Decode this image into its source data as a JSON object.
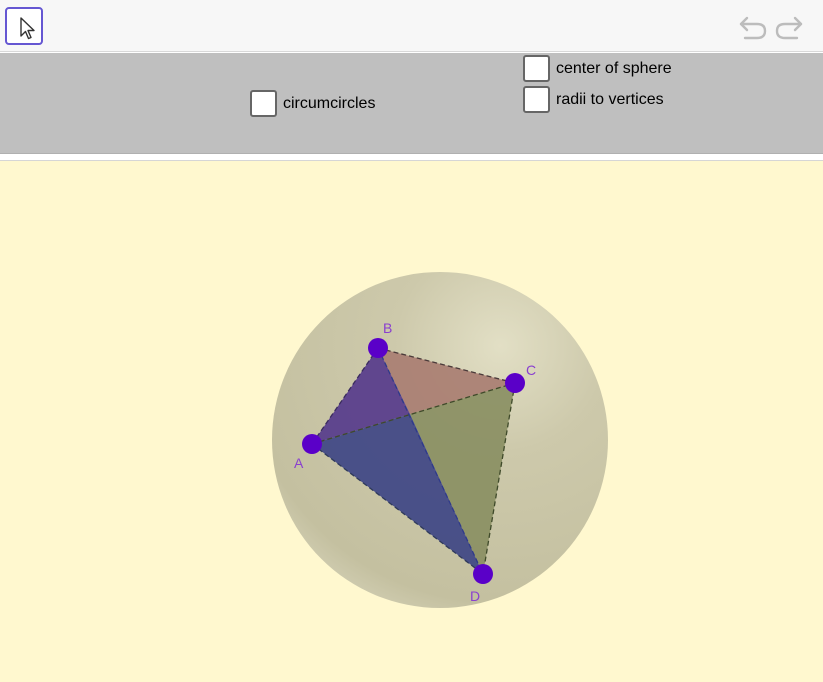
{
  "toolbar": {
    "move_tool_icon": "cursor-arrow-icon",
    "undo_icon": "undo-icon",
    "redo_icon": "redo-icon"
  },
  "controls": {
    "checkboxes": [
      {
        "label": "circumcircles",
        "checked": false
      },
      {
        "label": "center of sphere",
        "checked": false
      },
      {
        "label": "radii to vertices",
        "checked": false
      }
    ]
  },
  "scene": {
    "points": {
      "A": "A",
      "B": "B",
      "C": "C",
      "D": "D"
    },
    "colors": {
      "background": "#fff8cf",
      "sphere": "#c9c5a6",
      "point": "#5a00c8",
      "label": "#8a3fcf",
      "face_ABC": "#a97e72",
      "face_ABD": "#3f3f8f",
      "face_BCD": "#8a8f63"
    }
  }
}
